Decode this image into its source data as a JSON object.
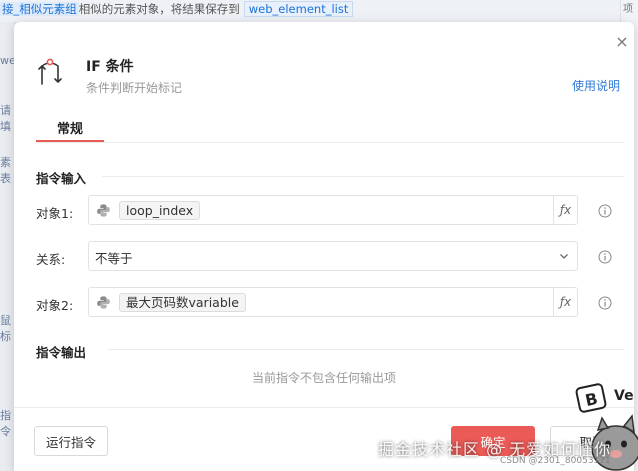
{
  "background": {
    "top_prefix": "接_相似元素组",
    "top_middle": "相似的元素对象，将结果保存到",
    "top_variable": "web_element_list",
    "left_fragments": [
      "we",
      "请填",
      "素表",
      "鼠标",
      "指令"
    ],
    "right_glyph": "项"
  },
  "dialog": {
    "close_glyph": "×",
    "title": "IF 条件",
    "subtitle": "条件判断开始标记",
    "help_link": "使用说明",
    "tabs": [
      {
        "label": "常规",
        "active": true
      }
    ],
    "input_section_title": "指令输入",
    "output_section_title": "指令输出",
    "fields": {
      "object1": {
        "label": "对象1:",
        "value": "loop_index",
        "fx": "ƒx"
      },
      "relation": {
        "label": "关系:",
        "value": "不等于"
      },
      "object2": {
        "label": "对象2:",
        "value": "最大页码数variable",
        "fx": "ƒx"
      }
    },
    "output_empty_note": "当前指令不包含任何输出项",
    "buttons": {
      "run": "运行指令",
      "ok": "确定",
      "cancel": "取消"
    }
  },
  "overlay": {
    "watermark": "掘金技术社区 @ 无爱如何懂你",
    "csdn": "CSDN @2301_80053171",
    "sticker_text": "B Ve"
  },
  "colors": {
    "accent_red": "#ea5b57",
    "link_blue": "#2f7ad8"
  }
}
